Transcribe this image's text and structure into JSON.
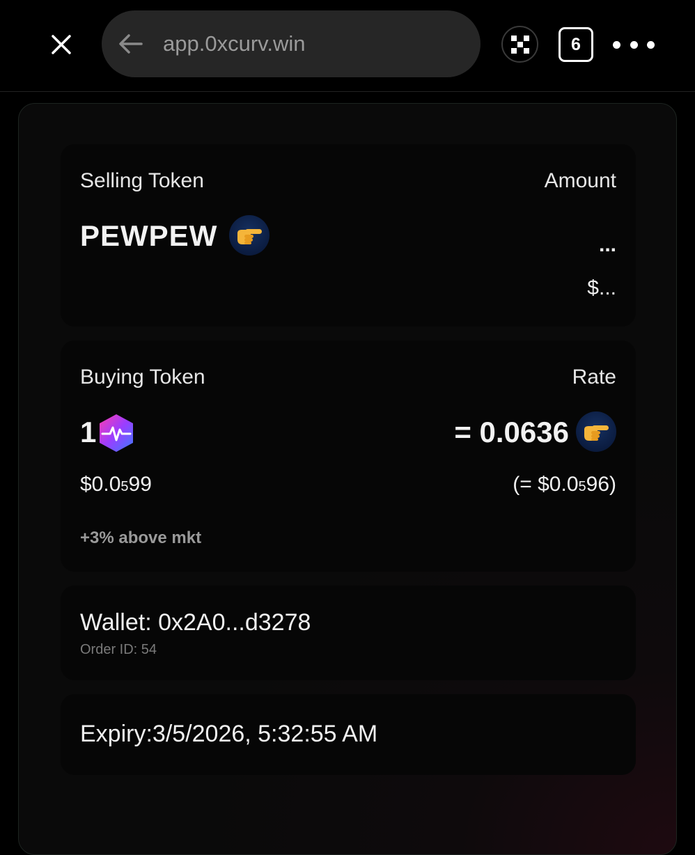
{
  "browser": {
    "url": "app.0xcurv.win",
    "tab_count": "6",
    "okx_icon": "okx-logo-icon",
    "accent": "#262626"
  },
  "sell_card": {
    "label": "Selling Token",
    "amount_label": "Amount",
    "token": "PEWPEW",
    "token_icon": "pointing-hand-icon",
    "amount_value": "...",
    "usd_value": "$..."
  },
  "buy_card": {
    "label": "Buying Token",
    "rate_label": "Rate",
    "amount": "1",
    "token_icon": "pulse-hexagon-icon",
    "usd_prefix": "$0.0",
    "usd_sub": "5",
    "usd_suffix": "99",
    "rate_value": "= 0.0636",
    "rate_token_icon": "pointing-hand-icon",
    "rate_usd_prefix": "(= $0.0",
    "rate_usd_sub": "5",
    "rate_usd_suffix": "96)",
    "above_market": "+3% above mkt"
  },
  "wallet_card": {
    "wallet": "Wallet: 0x2A0...d3278",
    "order_id": "Order ID: 54"
  },
  "expiry_card": {
    "expiry": "Expiry:3/5/2026, 5:32:55 AM"
  }
}
